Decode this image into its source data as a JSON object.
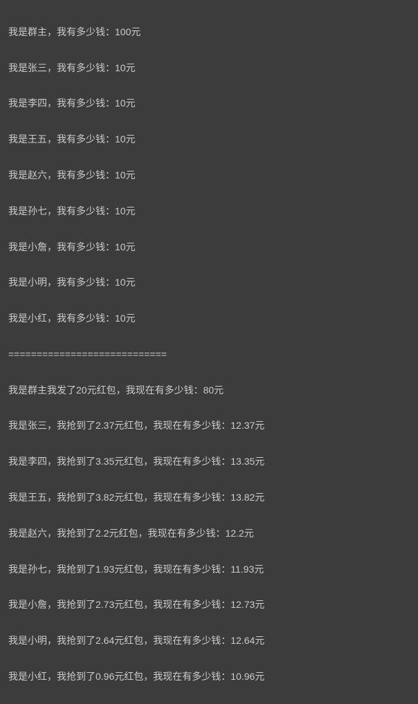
{
  "initial": [
    "我是群主，我有多少钱：100元",
    "我是张三，我有多少钱：10元",
    "我是李四，我有多少钱：10元",
    "我是王五，我有多少钱：10元",
    "我是赵六，我有多少钱：10元",
    "我是孙七，我有多少钱：10元",
    "我是小詹，我有多少钱：10元",
    "我是小明，我有多少钱：10元",
    "我是小红，我有多少钱：10元"
  ],
  "divider": "============================",
  "after": [
    "我是群主我发了20元红包，我现在有多少钱：80元",
    "我是张三，我抢到了2.37元红包，我现在有多少钱：12.37元",
    "我是李四，我抢到了3.35元红包，我现在有多少钱：13.35元",
    "我是王五，我抢到了3.82元红包，我现在有多少钱：13.82元",
    "我是赵六，我抢到了2.2元红包，我现在有多少钱：12.2元",
    "我是孙七，我抢到了1.93元红包，我现在有多少钱：11.93元",
    "我是小詹，我抢到了2.73元红包，我现在有多少钱：12.73元",
    "我是小明，我抢到了2.64元红包，我现在有多少钱：12.64元",
    "我是小红，我抢到了0.96元红包，我现在有多少钱：10.96元"
  ]
}
